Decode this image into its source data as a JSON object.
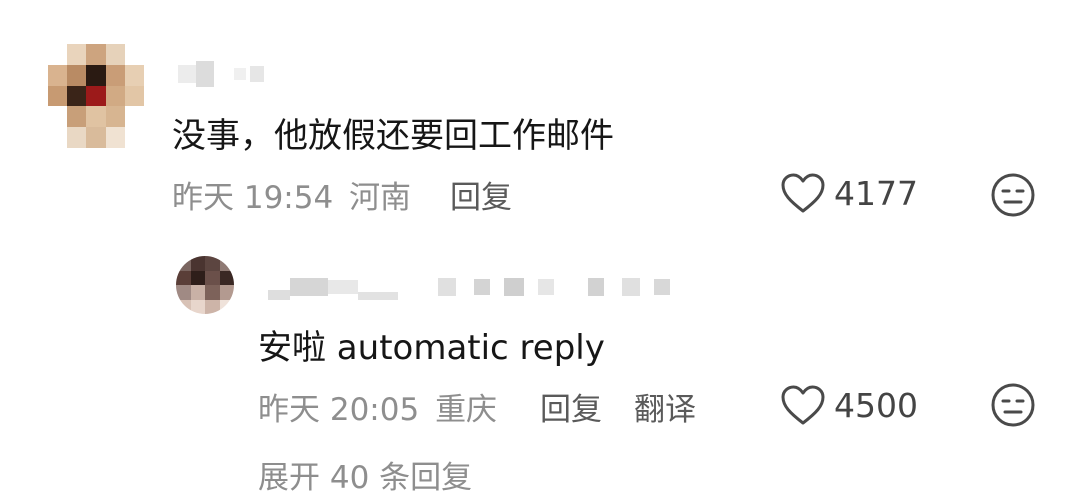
{
  "comment": {
    "text": "没事，他放假还要回工作邮件",
    "time": "昨天 19:54",
    "location": "河南",
    "reply_label": "回复",
    "likes": "4177"
  },
  "reply": {
    "text": "安啦 automatic reply",
    "time": "昨天 20:05",
    "location": "重庆",
    "reply_label": "回复",
    "translate_label": "翻译",
    "likes": "4500"
  },
  "more_replies": "展开 40 条回复",
  "icons": {
    "like": "heart-outline-icon",
    "dislike": "meh-face-icon"
  },
  "colors": {
    "meta": "#8e8e8e",
    "text": "#161616"
  }
}
